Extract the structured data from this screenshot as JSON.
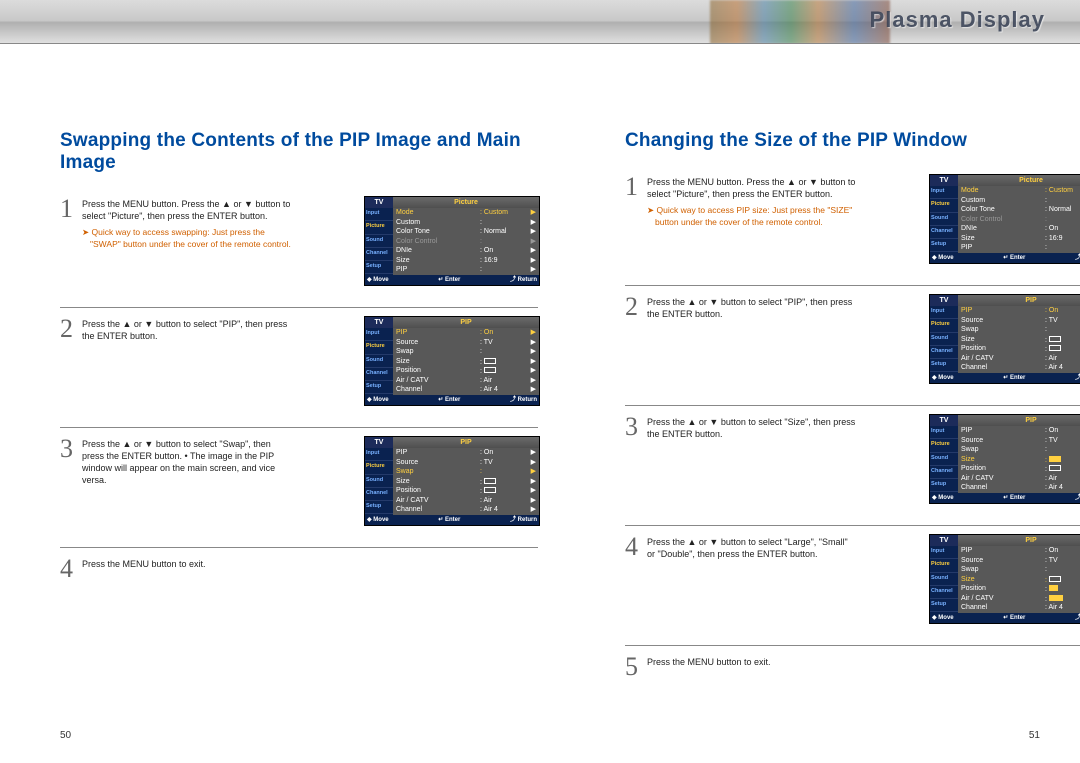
{
  "header": {
    "brand": "Plasma Display"
  },
  "page_numbers": {
    "left": "50",
    "right": "51"
  },
  "sidebar": {
    "tabs": [
      "Input",
      "Picture",
      "Sound",
      "Channel",
      "Setup"
    ]
  },
  "osd_footer": {
    "move": "Move",
    "enter": "Enter",
    "return": "Return",
    "move_sym": "◆",
    "enter_sym": "↵",
    "return_sym": "⤴"
  },
  "left_section": {
    "title": "Swapping the Contents of the PIP Image and Main Image",
    "steps": {
      "s1_num": "1",
      "s1_text": "Press the MENU button. Press the ▲ or ▼ button to select \"Picture\", then press the ENTER button.",
      "s1_quick": "Quick way to access swapping: Just press the \"SWAP\" button under the cover of the remote control.",
      "s2_num": "2",
      "s2_text": "Press the ▲ or ▼ button to select \"PIP\", then press the ENTER button.",
      "s3_num": "3",
      "s3_text": "Press the ▲ or ▼ button to select \"Swap\", then press the ENTER button.\n• The image in the PIP window will appear on the main screen, and vice versa.",
      "s4_num": "4",
      "s4_text": "Press the MENU button to exit."
    }
  },
  "right_section": {
    "title": "Changing the Size of the PIP Window",
    "steps": {
      "s1_num": "1",
      "s1_text": "Press the MENU button. Press the ▲ or ▼ button to select \"Picture\", then press the ENTER button.",
      "s1_quick": "Quick way to access PIP size: Just press the \"SIZE\" button under the cover of the remote control.",
      "s2_num": "2",
      "s2_text": "Press the ▲ or ▼ button to select \"PIP\", then press the ENTER button.",
      "s3_num": "3",
      "s3_text": "Press the ▲ or ▼ button to select \"Size\", then press the ENTER button.",
      "s4_num": "4",
      "s4_text": "Press the ▲ or ▼ button to select \"Large\", \"Small\" or \"Double\", then press the ENTER button.",
      "s5_num": "5",
      "s5_text": "Press the MENU button to exit."
    }
  },
  "osd_picture": {
    "title_l": "TV",
    "title_r": "Picture",
    "rows": {
      "mode_k": "Mode",
      "mode_v": "Custom",
      "custom_k": "Custom",
      "colortone_k": "Color Tone",
      "colortone_v": "Normal",
      "colorctrl_k": "Color Control",
      "dnie_k": "DNIe",
      "dnie_v": "On",
      "size_k": "Size",
      "size_v": "16:9",
      "pip_k": "PIP"
    }
  },
  "osd_pip_top": {
    "title_l": "TV",
    "title_r": "PIP",
    "rows": {
      "pip_k": "PIP",
      "pip_v": "On",
      "source_k": "Source",
      "source_v": "TV",
      "swap_k": "Swap",
      "size_k": "Size",
      "position_k": "Position",
      "air_k": "Air / CATV",
      "air_v": "Air",
      "channel_k": "Channel",
      "channel_v": "Air  4"
    }
  },
  "osd_pip_swap": {
    "title_l": "TV",
    "title_r": "PIP"
  },
  "osd_pip_size": {
    "title_l": "TV",
    "title_r": "PIP"
  },
  "osd_pip_size_open": {
    "title_l": "TV",
    "title_r": "PIP"
  }
}
